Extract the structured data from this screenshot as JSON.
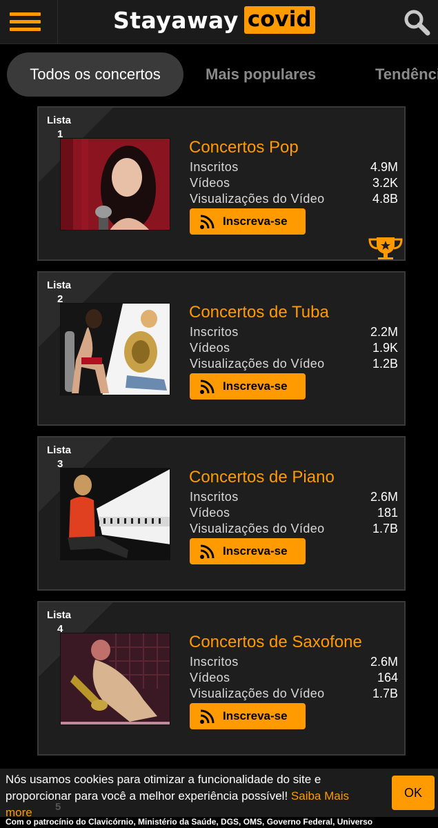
{
  "header": {
    "logo_part1": "Stayaway",
    "logo_part2": "covid",
    "menu_icon": "hamburger-menu-icon",
    "search_icon": "search-icon",
    "accent_color": "#ff9a00"
  },
  "tabs": [
    {
      "label": "Todos os concertos",
      "active": true
    },
    {
      "label": "Mais populares",
      "active": false
    },
    {
      "label": "Tendências",
      "active": false
    }
  ],
  "cards": [
    {
      "rank_label": "Lista",
      "rank": "1",
      "title": "Concertos Pop",
      "subscribers_label": "Inscritos",
      "subscribers": "4.9M",
      "videos_label": "Vídeos",
      "videos": "3.2K",
      "views_label": "Visualizações do Vídeo",
      "views": "4.8B",
      "button": "Inscreva-se"
    },
    {
      "rank_label": "Lista",
      "rank": "2",
      "title": "Concertos de Tuba",
      "subscribers_label": "Inscritos",
      "subscribers": "2.2M",
      "videos_label": "Vídeos",
      "videos": "1.9K",
      "views_label": "Visualizações do Vídeo",
      "views": "1.2B",
      "button": "Inscreva-se"
    },
    {
      "rank_label": "Lista",
      "rank": "3",
      "title": "Concertos de Piano",
      "subscribers_label": "Inscritos",
      "subscribers": "2.6M",
      "videos_label": "Vídeos",
      "videos": "181",
      "views_label": "Visualizações do Vídeo",
      "views": "1.7B",
      "button": "Inscreva-se"
    },
    {
      "rank_label": "Lista",
      "rank": "4",
      "title": "Concertos de Saxofone",
      "subscribers_label": "Inscritos",
      "subscribers": "2.6M",
      "videos_label": "Vídeos",
      "videos": "164",
      "views_label": "Visualizações do Vídeo",
      "views": "1.7B",
      "button": "Inscreva-se"
    }
  ],
  "partial_rank": "5",
  "cookie": {
    "text": "Nós usamos cookies para otimizar a funcionalidade do site e proporcionar para você a melhor experiência possível!",
    "link": "Saiba Mais more",
    "ok": "OK"
  },
  "footer": "Com o patrocínio do Clavicórnio, Ministério da Saúde, DGS, OMS, Governo Federal, Universo"
}
